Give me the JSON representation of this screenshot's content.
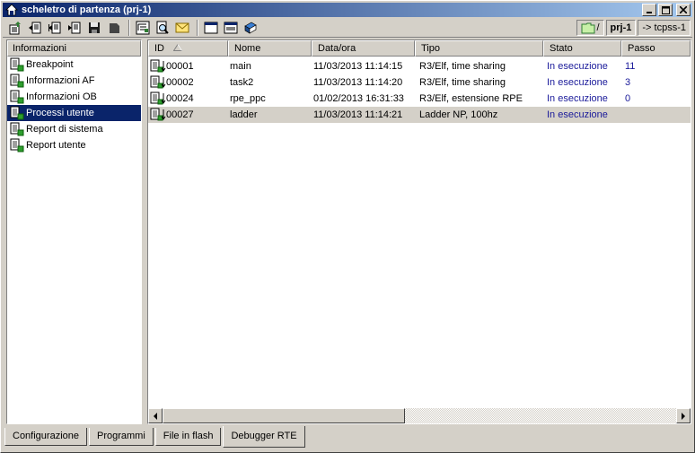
{
  "window": {
    "title": "scheletro di partenza (prj-1)"
  },
  "toolbar": {
    "tools": [
      "properties-icon",
      "back-icon",
      "back-all-icon",
      "forward-icon",
      "disk-icon",
      "stop-icon",
      "tree-icon",
      "find-icon",
      "mail-icon",
      "window-icon",
      "window-list-icon",
      "book-icon"
    ],
    "project_label": "prj-1",
    "target_label": "-> tcpss-1"
  },
  "sidebar": {
    "header": "Informazioni",
    "items": [
      {
        "label": "Breakpoint",
        "selected": false
      },
      {
        "label": "Informazioni AF",
        "selected": false
      },
      {
        "label": "Informazioni OB",
        "selected": false
      },
      {
        "label": "Processi utente",
        "selected": true
      },
      {
        "label": "Report di sistema",
        "selected": false
      },
      {
        "label": "Report utente",
        "selected": false
      }
    ]
  },
  "table": {
    "columns": [
      "ID",
      "Nome",
      "Data/ora",
      "Tipo",
      "Stato",
      "Passo"
    ],
    "rows": [
      {
        "id": "00001",
        "nome": "main",
        "data": "11/03/2013 11:14:15",
        "tipo": "R3/Elf, time sharing",
        "stato": "In esecuzione",
        "passo": "11",
        "highlight": false
      },
      {
        "id": "00002",
        "nome": "task2",
        "data": "11/03/2013 11:14:20",
        "tipo": "R3/Elf, time sharing",
        "stato": "In esecuzione",
        "passo": "3",
        "highlight": false
      },
      {
        "id": "00024",
        "nome": "rpe_ppc",
        "data": "01/02/2013 16:31:33",
        "tipo": "R3/Elf, estensione RPE",
        "stato": "In esecuzione",
        "passo": "0",
        "highlight": false
      },
      {
        "id": "00027",
        "nome": "ladder",
        "data": "11/03/2013 11:14:21",
        "tipo": "Ladder NP, 100hz",
        "stato": "In esecuzione",
        "passo": "",
        "highlight": true
      }
    ]
  },
  "tabs": [
    {
      "label": "Configurazione",
      "active": false
    },
    {
      "label": "Programmi",
      "active": false
    },
    {
      "label": "File in flash",
      "active": false
    },
    {
      "label": "Debugger RTE",
      "active": true
    }
  ],
  "colors": {
    "title_start": "#0a246a",
    "title_end": "#a6caf0",
    "selection": "#0a246a",
    "status_text": "#1a1a9a"
  }
}
